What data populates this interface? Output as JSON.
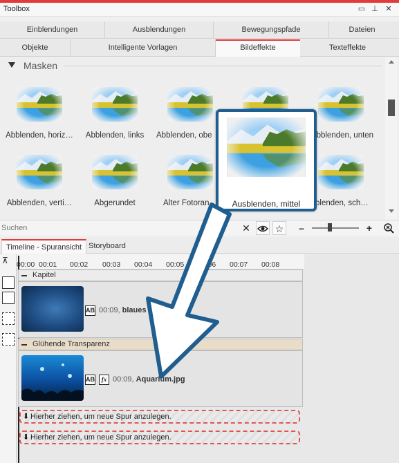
{
  "window": {
    "title": "Toolbox",
    "controls": [
      "▭",
      "⊥",
      "✕"
    ]
  },
  "tabs_row1": [
    "Einblendungen",
    "Ausblendungen",
    "Bewegungspfade",
    "Dateien"
  ],
  "tabs_row2": [
    "Objekte",
    "Intelligente Vorlagen",
    "Bildeffekte",
    "Texteffekte"
  ],
  "active_tab": "Bildeffekte",
  "section": {
    "title": "Masken"
  },
  "effects": [
    "Abblenden, horiz…",
    "Abblenden, links",
    "Abblenden, obe",
    "",
    "Abblenden, unten",
    "Abblenden, verti…",
    "Abgerundet",
    "Alter Fotoran",
    "",
    "blenden, sch…"
  ],
  "selected_effect": {
    "label": "Ausblenden, mittel"
  },
  "search": {
    "placeholder": "Suchen"
  },
  "search_icons": [
    "close-icon",
    "eye-icon",
    "star-icon",
    "minus-icon",
    "plus-icon",
    "zoom-fit-icon"
  ],
  "timeline": {
    "tabs": [
      "Timeline - Spuransicht",
      "Storyboard"
    ],
    "ruler": [
      "00:00",
      "00:01",
      "00:02",
      "00:03",
      "00:04",
      "00:05",
      "00:06",
      "00:07",
      "00:08"
    ],
    "chapter": {
      "label": "Kapitel",
      "duration": "00:09,",
      "name": "blaues li"
    },
    "track2": {
      "label": "Glühende Transparenz",
      "duration": "00:09,",
      "name": "Aquarium.jpg"
    },
    "dropzones": [
      "Hierher ziehen, um neue Spur anzulegen.",
      "Hierher ziehen, um neue Spur anzulegen."
    ]
  },
  "colors": {
    "accent": "#e33b3b",
    "highlight": "#1f5e8f"
  }
}
